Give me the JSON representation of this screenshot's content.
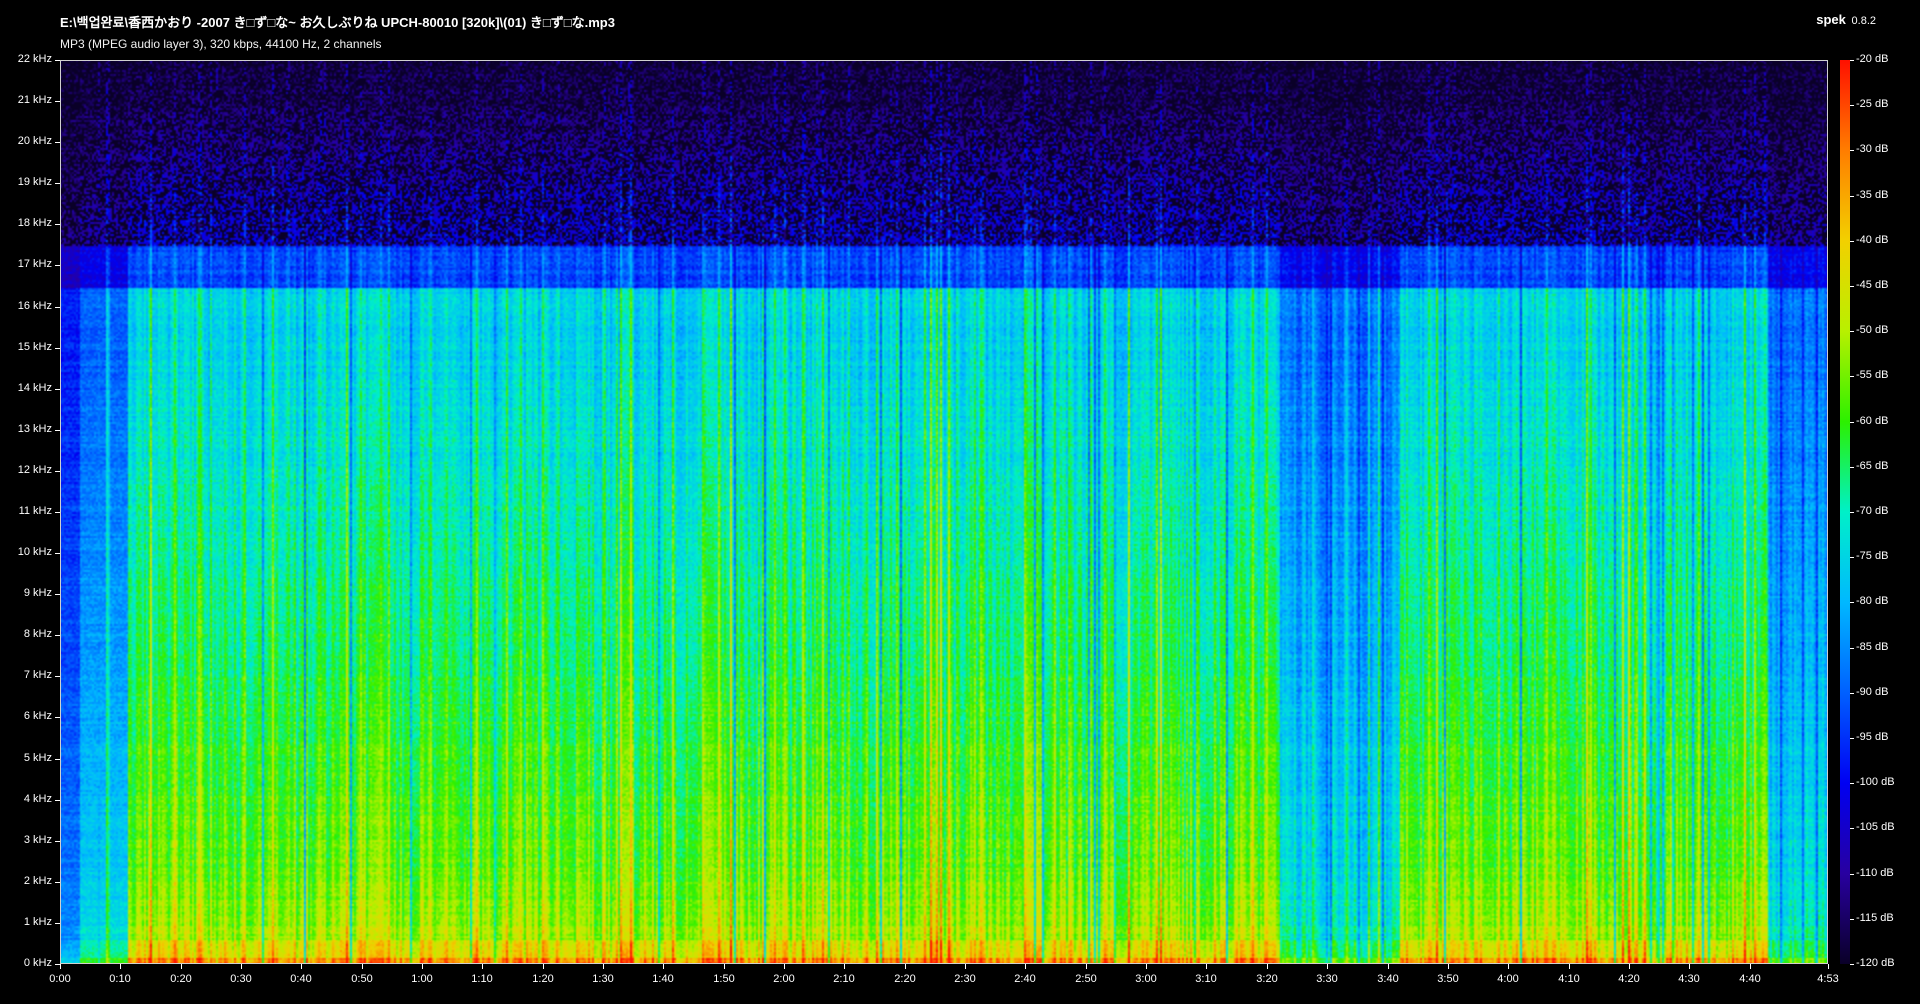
{
  "header": {
    "file_path": "E:\\백업완료\\香西かおり -2007 き□ず□な~ お久しぶりね UPCH-80010 [320k]\\(01) き□ず□な.mp3",
    "stream_info": "MP3 (MPEG audio layer 3), 320 kbps, 44100 Hz, 2 channels",
    "app_name": "spek",
    "app_version": "0.8.2"
  },
  "axes": {
    "freq_labels": [
      "22 kHz",
      "21 kHz",
      "20 kHz",
      "19 kHz",
      "18 kHz",
      "17 kHz",
      "16 kHz",
      "15 kHz",
      "14 kHz",
      "13 kHz",
      "12 kHz",
      "11 kHz",
      "10 kHz",
      "9 kHz",
      "8 kHz",
      "7 kHz",
      "6 kHz",
      "5 kHz",
      "4 kHz",
      "3 kHz",
      "2 kHz",
      "1 kHz",
      "0 kHz"
    ],
    "time_labels": [
      "0:00",
      "0:10",
      "0:20",
      "0:30",
      "0:40",
      "0:50",
      "1:00",
      "1:10",
      "1:20",
      "1:30",
      "1:40",
      "1:50",
      "2:00",
      "2:10",
      "2:20",
      "2:30",
      "2:40",
      "2:50",
      "3:00",
      "3:10",
      "3:20",
      "3:30",
      "3:40",
      "3:50",
      "4:00",
      "4:10",
      "4:20",
      "4:30",
      "4:40",
      "4:53"
    ],
    "time_seconds": [
      0,
      10,
      20,
      30,
      40,
      50,
      60,
      70,
      80,
      90,
      100,
      110,
      120,
      130,
      140,
      150,
      160,
      170,
      180,
      190,
      200,
      210,
      220,
      230,
      240,
      250,
      260,
      270,
      280,
      293
    ],
    "duration_seconds": 293,
    "freq_max_khz": 22,
    "db_labels": [
      "-20 dB",
      "-25 dB",
      "-30 dB",
      "-35 dB",
      "-40 dB",
      "-45 dB",
      "-50 dB",
      "-55 dB",
      "-60 dB",
      "-65 dB",
      "-70 dB",
      "-75 dB",
      "-80 dB",
      "-85 dB",
      "-90 dB",
      "-95 dB",
      "-100 dB",
      "-105 dB",
      "-110 dB",
      "-115 dB",
      "-120 dB"
    ]
  },
  "spectrogram": {
    "cutoff_khz": 16.5,
    "quiet_regions_seconds": [
      [
        202,
        222
      ],
      [
        283,
        293
      ]
    ],
    "colors": {
      "background": "#000000",
      "scale_top": "#ff1000",
      "scale_bottom": "#0a0028"
    }
  }
}
